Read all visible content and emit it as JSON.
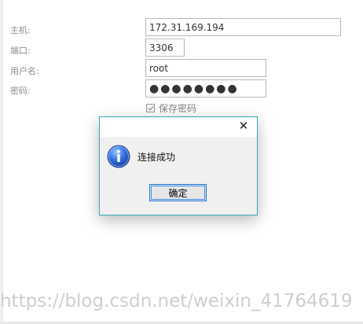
{
  "form": {
    "host_label": "主机:",
    "host_value": "172.31.169.194",
    "port_label": "端口:",
    "port_value": "3306",
    "user_label": "用户名:",
    "user_value": "root",
    "password_label": "密码:",
    "password_value": "●●●●●●●●",
    "save_password_label": "保存密码",
    "save_password_checked": true
  },
  "dialog": {
    "close_glyph": "✕",
    "icon": "info-icon",
    "message": "连接成功",
    "ok_label": "确定",
    "border_color": "#39a7b6"
  },
  "watermark": "https://blog.csdn.net/weixin_41764619"
}
